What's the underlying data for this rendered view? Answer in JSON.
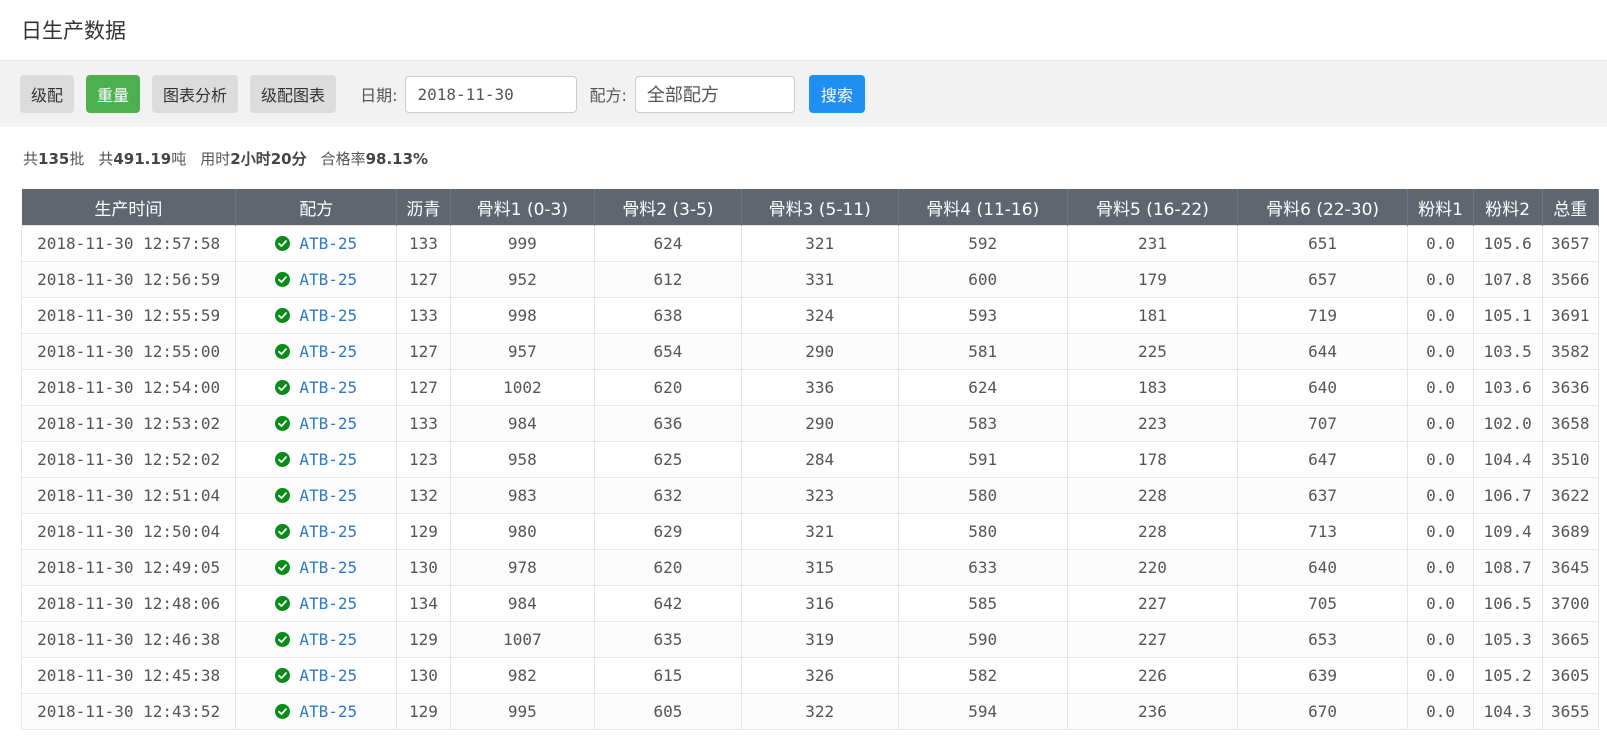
{
  "page": {
    "title": "日生产数据"
  },
  "toolbar": {
    "buttons": [
      {
        "label": "级配",
        "active": false
      },
      {
        "label": "重量",
        "active": true
      },
      {
        "label": "图表分析",
        "active": false
      },
      {
        "label": "级配图表",
        "active": false
      }
    ],
    "date_label": "日期:",
    "date_value": "2018-11-30",
    "recipe_label": "配方:",
    "recipe_value": "全部配方",
    "search_label": "搜索",
    "active_color": "#4cb050",
    "search_color": "#1f8ff2"
  },
  "summary": {
    "batches_prefix": "共",
    "batches_value": "135",
    "batches_suffix": "批",
    "tons_prefix": "共",
    "tons_value": "491.19",
    "tons_suffix": "吨",
    "time_prefix": "用时",
    "time_value": "2小时20分",
    "rate_prefix": "合格率",
    "rate_value": "98.13%"
  },
  "table": {
    "columns": [
      "生产时间",
      "配方",
      "沥青",
      "骨料1 (0-3)",
      "骨料2 (3-5)",
      "骨料3 (5-11)",
      "骨料4 (11-16)",
      "骨料5 (16-22)",
      "骨料6 (22-30)",
      "粉料1",
      "粉料2",
      "总重"
    ],
    "status_icon": "check-circle-icon",
    "status_color": "#0a8a19",
    "rows": [
      [
        "2018-11-30 12:57:58",
        "ATB-25",
        "133",
        "999",
        "624",
        "321",
        "592",
        "231",
        "651",
        "0.0",
        "105.6",
        "3657"
      ],
      [
        "2018-11-30 12:56:59",
        "ATB-25",
        "127",
        "952",
        "612",
        "331",
        "600",
        "179",
        "657",
        "0.0",
        "107.8",
        "3566"
      ],
      [
        "2018-11-30 12:55:59",
        "ATB-25",
        "133",
        "998",
        "638",
        "324",
        "593",
        "181",
        "719",
        "0.0",
        "105.1",
        "3691"
      ],
      [
        "2018-11-30 12:55:00",
        "ATB-25",
        "127",
        "957",
        "654",
        "290",
        "581",
        "225",
        "644",
        "0.0",
        "103.5",
        "3582"
      ],
      [
        "2018-11-30 12:54:00",
        "ATB-25",
        "127",
        "1002",
        "620",
        "336",
        "624",
        "183",
        "640",
        "0.0",
        "103.6",
        "3636"
      ],
      [
        "2018-11-30 12:53:02",
        "ATB-25",
        "133",
        "984",
        "636",
        "290",
        "583",
        "223",
        "707",
        "0.0",
        "102.0",
        "3658"
      ],
      [
        "2018-11-30 12:52:02",
        "ATB-25",
        "123",
        "958",
        "625",
        "284",
        "591",
        "178",
        "647",
        "0.0",
        "104.4",
        "3510"
      ],
      [
        "2018-11-30 12:51:04",
        "ATB-25",
        "132",
        "983",
        "632",
        "323",
        "580",
        "228",
        "637",
        "0.0",
        "106.7",
        "3622"
      ],
      [
        "2018-11-30 12:50:04",
        "ATB-25",
        "129",
        "980",
        "629",
        "321",
        "580",
        "228",
        "713",
        "0.0",
        "109.4",
        "3689"
      ],
      [
        "2018-11-30 12:49:05",
        "ATB-25",
        "130",
        "978",
        "620",
        "315",
        "633",
        "220",
        "640",
        "0.0",
        "108.7",
        "3645"
      ],
      [
        "2018-11-30 12:48:06",
        "ATB-25",
        "134",
        "984",
        "642",
        "316",
        "585",
        "227",
        "705",
        "0.0",
        "106.5",
        "3700"
      ],
      [
        "2018-11-30 12:46:38",
        "ATB-25",
        "129",
        "1007",
        "635",
        "319",
        "590",
        "227",
        "653",
        "0.0",
        "105.3",
        "3665"
      ],
      [
        "2018-11-30 12:45:38",
        "ATB-25",
        "130",
        "982",
        "615",
        "326",
        "582",
        "226",
        "639",
        "0.0",
        "105.2",
        "3605"
      ],
      [
        "2018-11-30 12:43:52",
        "ATB-25",
        "129",
        "995",
        "605",
        "322",
        "594",
        "236",
        "670",
        "0.0",
        "104.3",
        "3655"
      ]
    ]
  }
}
